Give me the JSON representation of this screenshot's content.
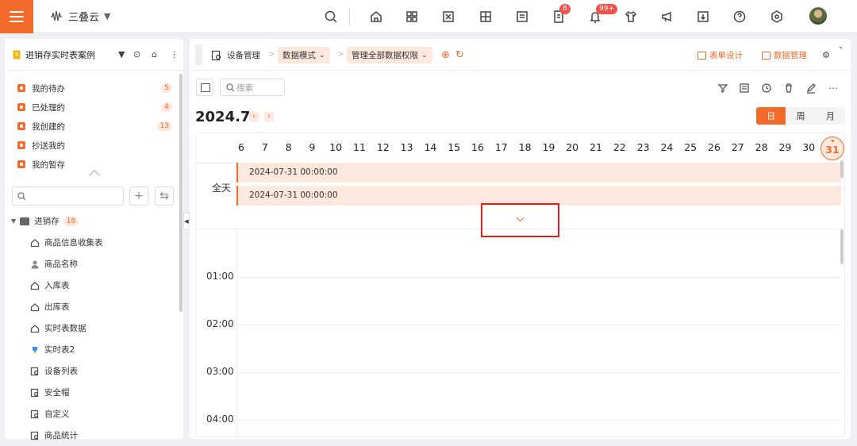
{
  "topbar": {
    "brand_name": "三叠云",
    "accent": "#f26b2a",
    "icons": [
      "search-icon",
      "home-icon",
      "apps-icon",
      "workflow-icon",
      "grid-icon",
      "form-icon",
      "tasks-icon",
      "bell-icon",
      "shirt-icon",
      "megaphone-icon",
      "download-icon",
      "help-icon",
      "settings-icon"
    ],
    "tasks_badge": "8",
    "bell_badge": "99+"
  },
  "sidebar": {
    "title": "进销存实时表案例",
    "tasks": [
      {
        "label": "我的待办",
        "count": "5"
      },
      {
        "label": "已处理的",
        "count": "4"
      },
      {
        "label": "我创建的",
        "count": "13"
      },
      {
        "label": "抄送我的",
        "count": ""
      },
      {
        "label": "我的暂存",
        "count": ""
      }
    ],
    "tree_root": {
      "label": "进销存",
      "count": "18"
    },
    "tree_items": [
      {
        "label": "商品信息收集表",
        "icon": "home-icon"
      },
      {
        "label": "商品名称",
        "icon": "person-icon"
      },
      {
        "label": "入库表",
        "icon": "home-icon"
      },
      {
        "label": "出库表",
        "icon": "home-icon"
      },
      {
        "label": "实时表数据",
        "icon": "home-icon"
      },
      {
        "label": "实时表2",
        "icon": "trophy-icon"
      },
      {
        "label": "设备列表",
        "icon": "doc-search-icon"
      },
      {
        "label": "安全帽",
        "icon": "doc-search-icon"
      },
      {
        "label": "自定义",
        "icon": "doc-search-icon"
      },
      {
        "label": "商品统计",
        "icon": "doc-search-icon"
      }
    ]
  },
  "breadcrumb": {
    "root": "设备管理",
    "mode": "数据模式",
    "perm": "管理全部数据权限",
    "form_design": "表单设计",
    "data_manage": "数据管理"
  },
  "toolbar": {
    "search_placeholder": "搜索"
  },
  "calendar": {
    "month": "2024.7",
    "views": [
      "日",
      "周",
      "月"
    ],
    "active_view": "日",
    "days": [
      "6",
      "7",
      "8",
      "9",
      "10",
      "11",
      "12",
      "13",
      "14",
      "15",
      "16",
      "17",
      "18",
      "19",
      "20",
      "21",
      "22",
      "23",
      "24",
      "25",
      "26",
      "27",
      "28",
      "29",
      "30",
      "31"
    ],
    "today": "31",
    "allday_label": "全天",
    "events": [
      "2024-07-31 00:00:00",
      "2024-07-31 00:00:00"
    ],
    "hours": [
      "01:00",
      "02:00",
      "03:00",
      "04:00"
    ]
  }
}
